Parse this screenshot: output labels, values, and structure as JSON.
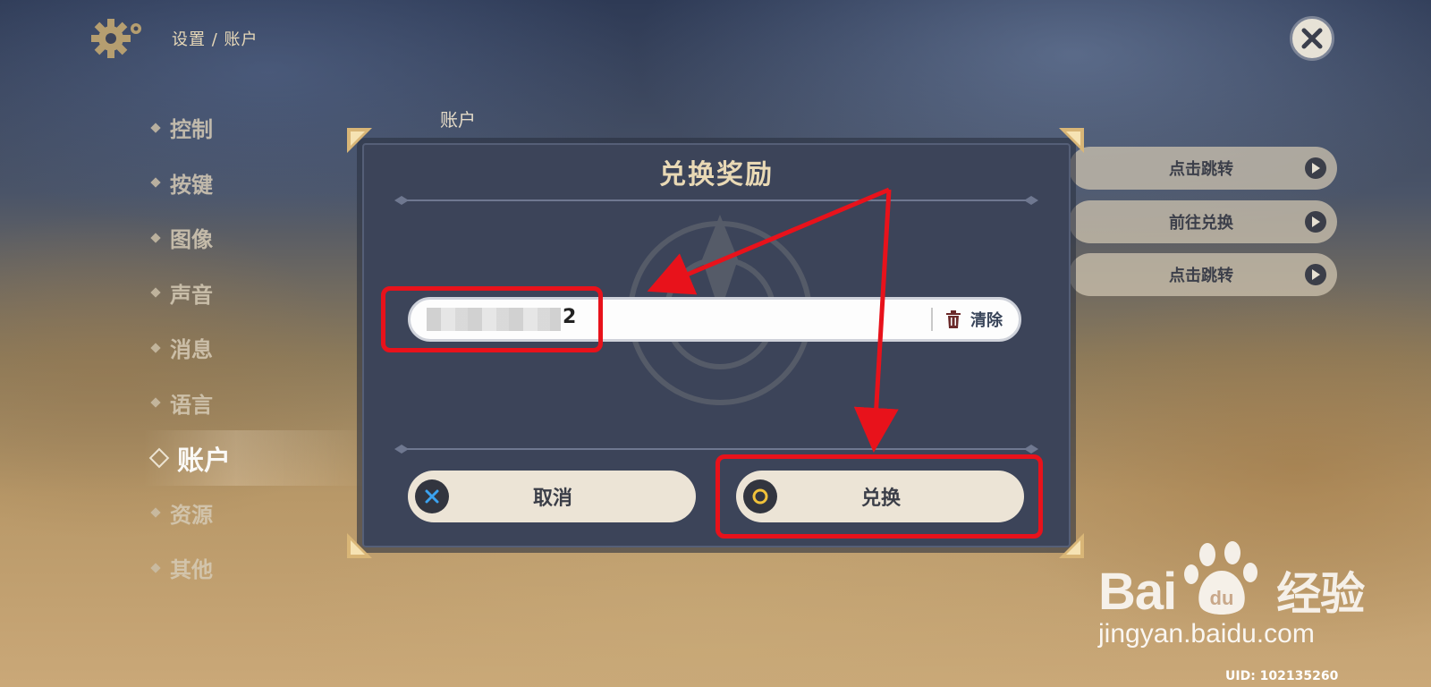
{
  "header": {
    "breadcrumb": "设置 / 账户"
  },
  "sidebar": {
    "items": [
      {
        "label": "控制"
      },
      {
        "label": "按键"
      },
      {
        "label": "图像"
      },
      {
        "label": "声音"
      },
      {
        "label": "消息"
      },
      {
        "label": "语言"
      },
      {
        "label": "账户",
        "active": true
      },
      {
        "label": "资源"
      },
      {
        "label": "其他"
      }
    ]
  },
  "main": {
    "section_label": "账户",
    "right_buttons": [
      {
        "label": "点击跳转"
      },
      {
        "label": "前往兑换"
      },
      {
        "label": "点击跳转"
      }
    ]
  },
  "dialog": {
    "title": "兑换奖励",
    "code_value_visible_suffix": "2",
    "clear_label": "清除",
    "cancel_label": "取消",
    "redeem_label": "兑换"
  },
  "watermark": {
    "brand_latin": "Bai",
    "brand_cn": "经验",
    "url": "jingyan.baidu.com"
  },
  "uid": "UID: 102135260",
  "colors": {
    "annotation_red": "#e8121b",
    "dialog_bg": "#3c4459",
    "title_gold": "#e9d9b5"
  },
  "icons": [
    "gear-icon",
    "close-icon",
    "trash-icon",
    "cross-icon",
    "circle-icon",
    "arrow-right-icon",
    "paw-icon"
  ]
}
